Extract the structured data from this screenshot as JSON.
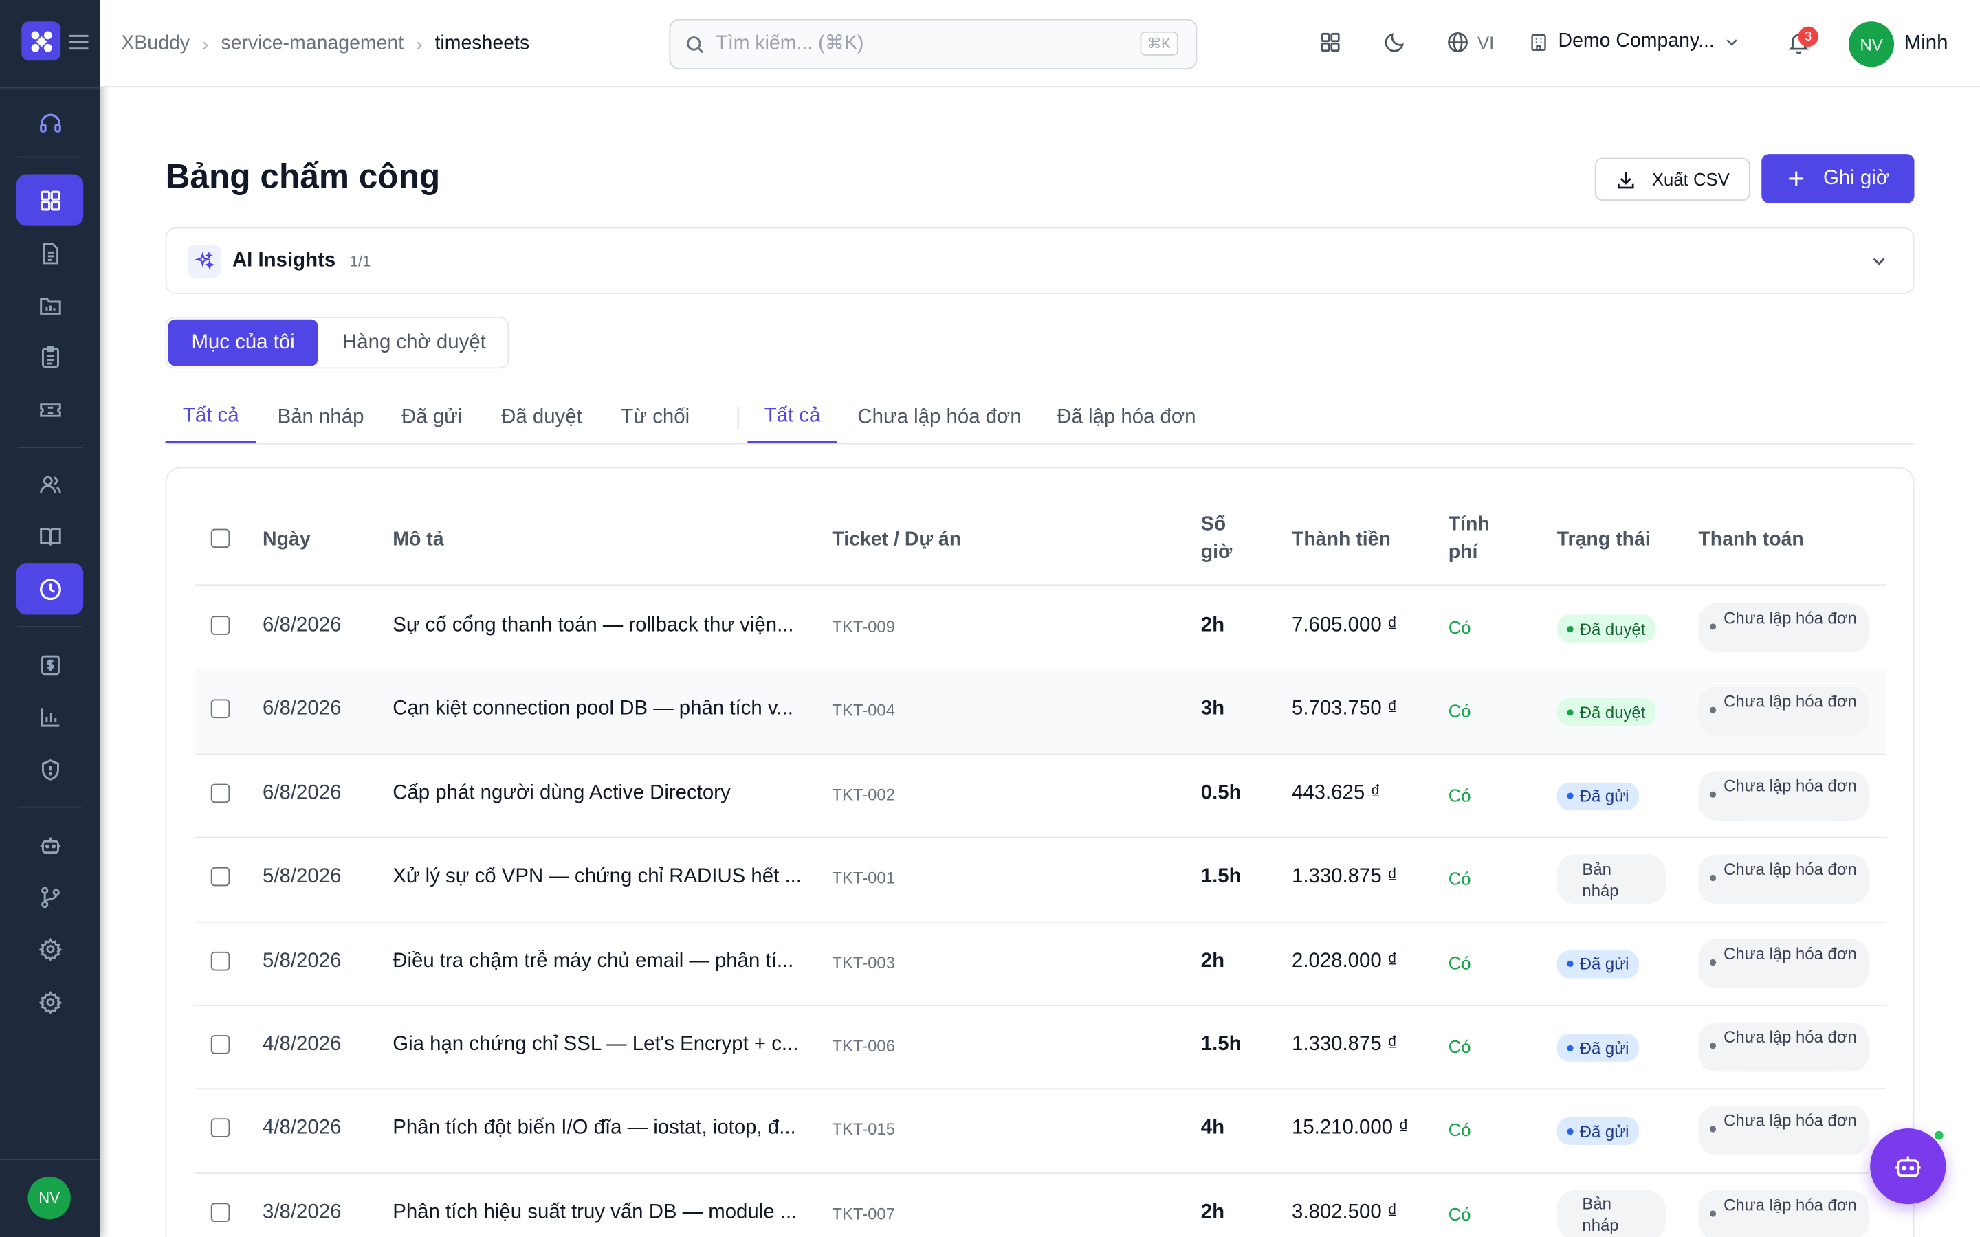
{
  "breadcrumb": [
    "XBuddy",
    "service-management",
    "timesheets"
  ],
  "search": {
    "placeholder": "Tìm kiếm... (⌘K)",
    "shortcut": "⌘K"
  },
  "topbar": {
    "language": "VI",
    "company": "Demo Company...",
    "notifications": "3",
    "user_initials": "NV",
    "user_name": "Minh"
  },
  "sidebar": {
    "avatar": "NV",
    "active_item": "timesheets-clock"
  },
  "page": {
    "title": "Bảng chấm công",
    "export_label": "Xuất CSV",
    "add_label": "Ghi giờ"
  },
  "ai": {
    "label": "AI Insights",
    "count": "1/1"
  },
  "segment": {
    "mine": "Mục của tôi",
    "queue": "Hàng chờ duyệt"
  },
  "tabs_status": [
    "Tất cả",
    "Bản nháp",
    "Đã gửi",
    "Đã duyệt",
    "Từ chối"
  ],
  "tabs_invoice": [
    "Tất cả",
    "Chưa lập hóa đơn",
    "Đã lập hóa đơn"
  ],
  "table": {
    "headers": {
      "date": "Ngày",
      "desc": "Mô tả",
      "ticket": "Ticket / Dự án",
      "hours": "Số giờ",
      "amount": "Thành tiền",
      "billable": "Tính phí",
      "status": "Trạng thái",
      "invoice": "Thanh toán"
    },
    "rows": [
      {
        "date": "6/8/2026",
        "desc": "Sự cố cổng thanh toán — rollback thư viện...",
        "ticket": "TKT-009",
        "hours": "2h",
        "amount": "7.605.000 ₫",
        "billable": "Có",
        "status": "Đã duyệt",
        "status_kind": "approved",
        "invoice": "Chưa lập hóa đơn"
      },
      {
        "date": "6/8/2026",
        "desc": "Cạn kiệt connection pool DB — phân tích v...",
        "ticket": "TKT-004",
        "hours": "3h",
        "amount": "5.703.750 ₫",
        "billable": "Có",
        "status": "Đã duyệt",
        "status_kind": "approved",
        "invoice": "Chưa lập hóa đơn"
      },
      {
        "date": "6/8/2026",
        "desc": "Cấp phát người dùng Active Directory",
        "ticket": "TKT-002",
        "hours": "0.5h",
        "amount": "443.625 ₫",
        "billable": "Có",
        "status": "Đã gửi",
        "status_kind": "sent",
        "invoice": "Chưa lập hóa đơn"
      },
      {
        "date": "5/8/2026",
        "desc": "Xử lý sự cố VPN — chứng chỉ RADIUS hết ...",
        "ticket": "TKT-001",
        "hours": "1.5h",
        "amount": "1.330.875 ₫",
        "billable": "Có",
        "status": "Bản nháp",
        "status_kind": "draft",
        "invoice": "Chưa lập hóa đơn"
      },
      {
        "date": "5/8/2026",
        "desc": "Điều tra chậm trễ máy chủ email — phân tí...",
        "ticket": "TKT-003",
        "hours": "2h",
        "amount": "2.028.000 ₫",
        "billable": "Có",
        "status": "Đã gửi",
        "status_kind": "sent",
        "invoice": "Chưa lập hóa đơn"
      },
      {
        "date": "4/8/2026",
        "desc": "Gia hạn chứng chỉ SSL — Let's Encrypt + c...",
        "ticket": "TKT-006",
        "hours": "1.5h",
        "amount": "1.330.875 ₫",
        "billable": "Có",
        "status": "Đã gửi",
        "status_kind": "sent",
        "invoice": "Chưa lập hóa đơn"
      },
      {
        "date": "4/8/2026",
        "desc": "Phân tích đột biến I/O đĩa — iostat, iotop, đ...",
        "ticket": "TKT-015",
        "hours": "4h",
        "amount": "15.210.000 ₫",
        "billable": "Có",
        "status": "Đã gửi",
        "status_kind": "sent",
        "invoice": "Chưa lập hóa đơn"
      },
      {
        "date": "3/8/2026",
        "desc": "Phân tích hiệu suất truy vấn DB — module ...",
        "ticket": "TKT-007",
        "hours": "2h",
        "amount": "3.802.500 ₫",
        "billable": "Có",
        "status": "Bản nháp",
        "status_kind": "draft",
        "invoice": "Chưa lập hóa đơn"
      }
    ]
  },
  "colors": {
    "accent": "#4f46e5",
    "sidebar": "#1e293b",
    "approved": "#16a34a",
    "sent": "#2563eb",
    "fab": "#7c3aed"
  }
}
